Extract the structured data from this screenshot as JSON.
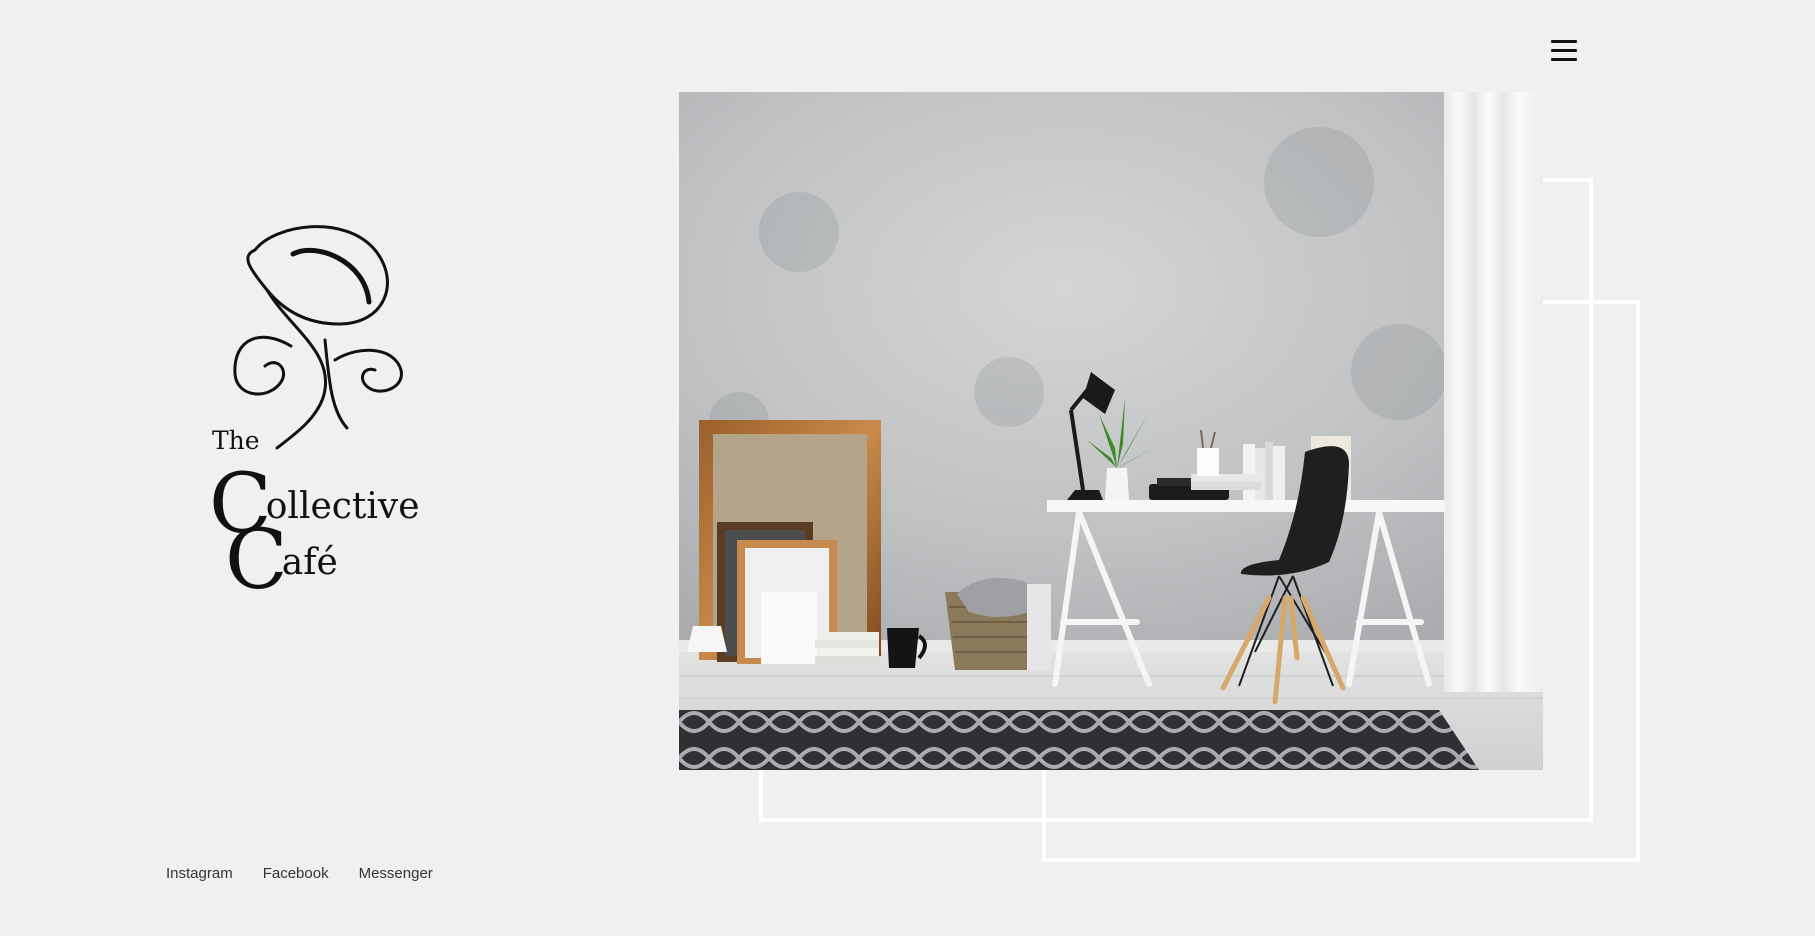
{
  "header": {
    "menu_icon": "hamburger-menu-icon"
  },
  "logo": {
    "word_the": "The",
    "line1_initial": "C",
    "line1_rest": "ollective",
    "line2_initial": "C",
    "line2_rest": "afé"
  },
  "hero": {
    "image_alt": "Home office with desk, black chair, lamp, plant and framed canvases against a concrete wall"
  },
  "social": {
    "links": [
      {
        "label": "Instagram"
      },
      {
        "label": "Facebook"
      },
      {
        "label": "Messenger"
      }
    ]
  },
  "colors": {
    "background": "#f0f0f0",
    "frame_stroke": "#ffffff",
    "text": "#111111"
  }
}
